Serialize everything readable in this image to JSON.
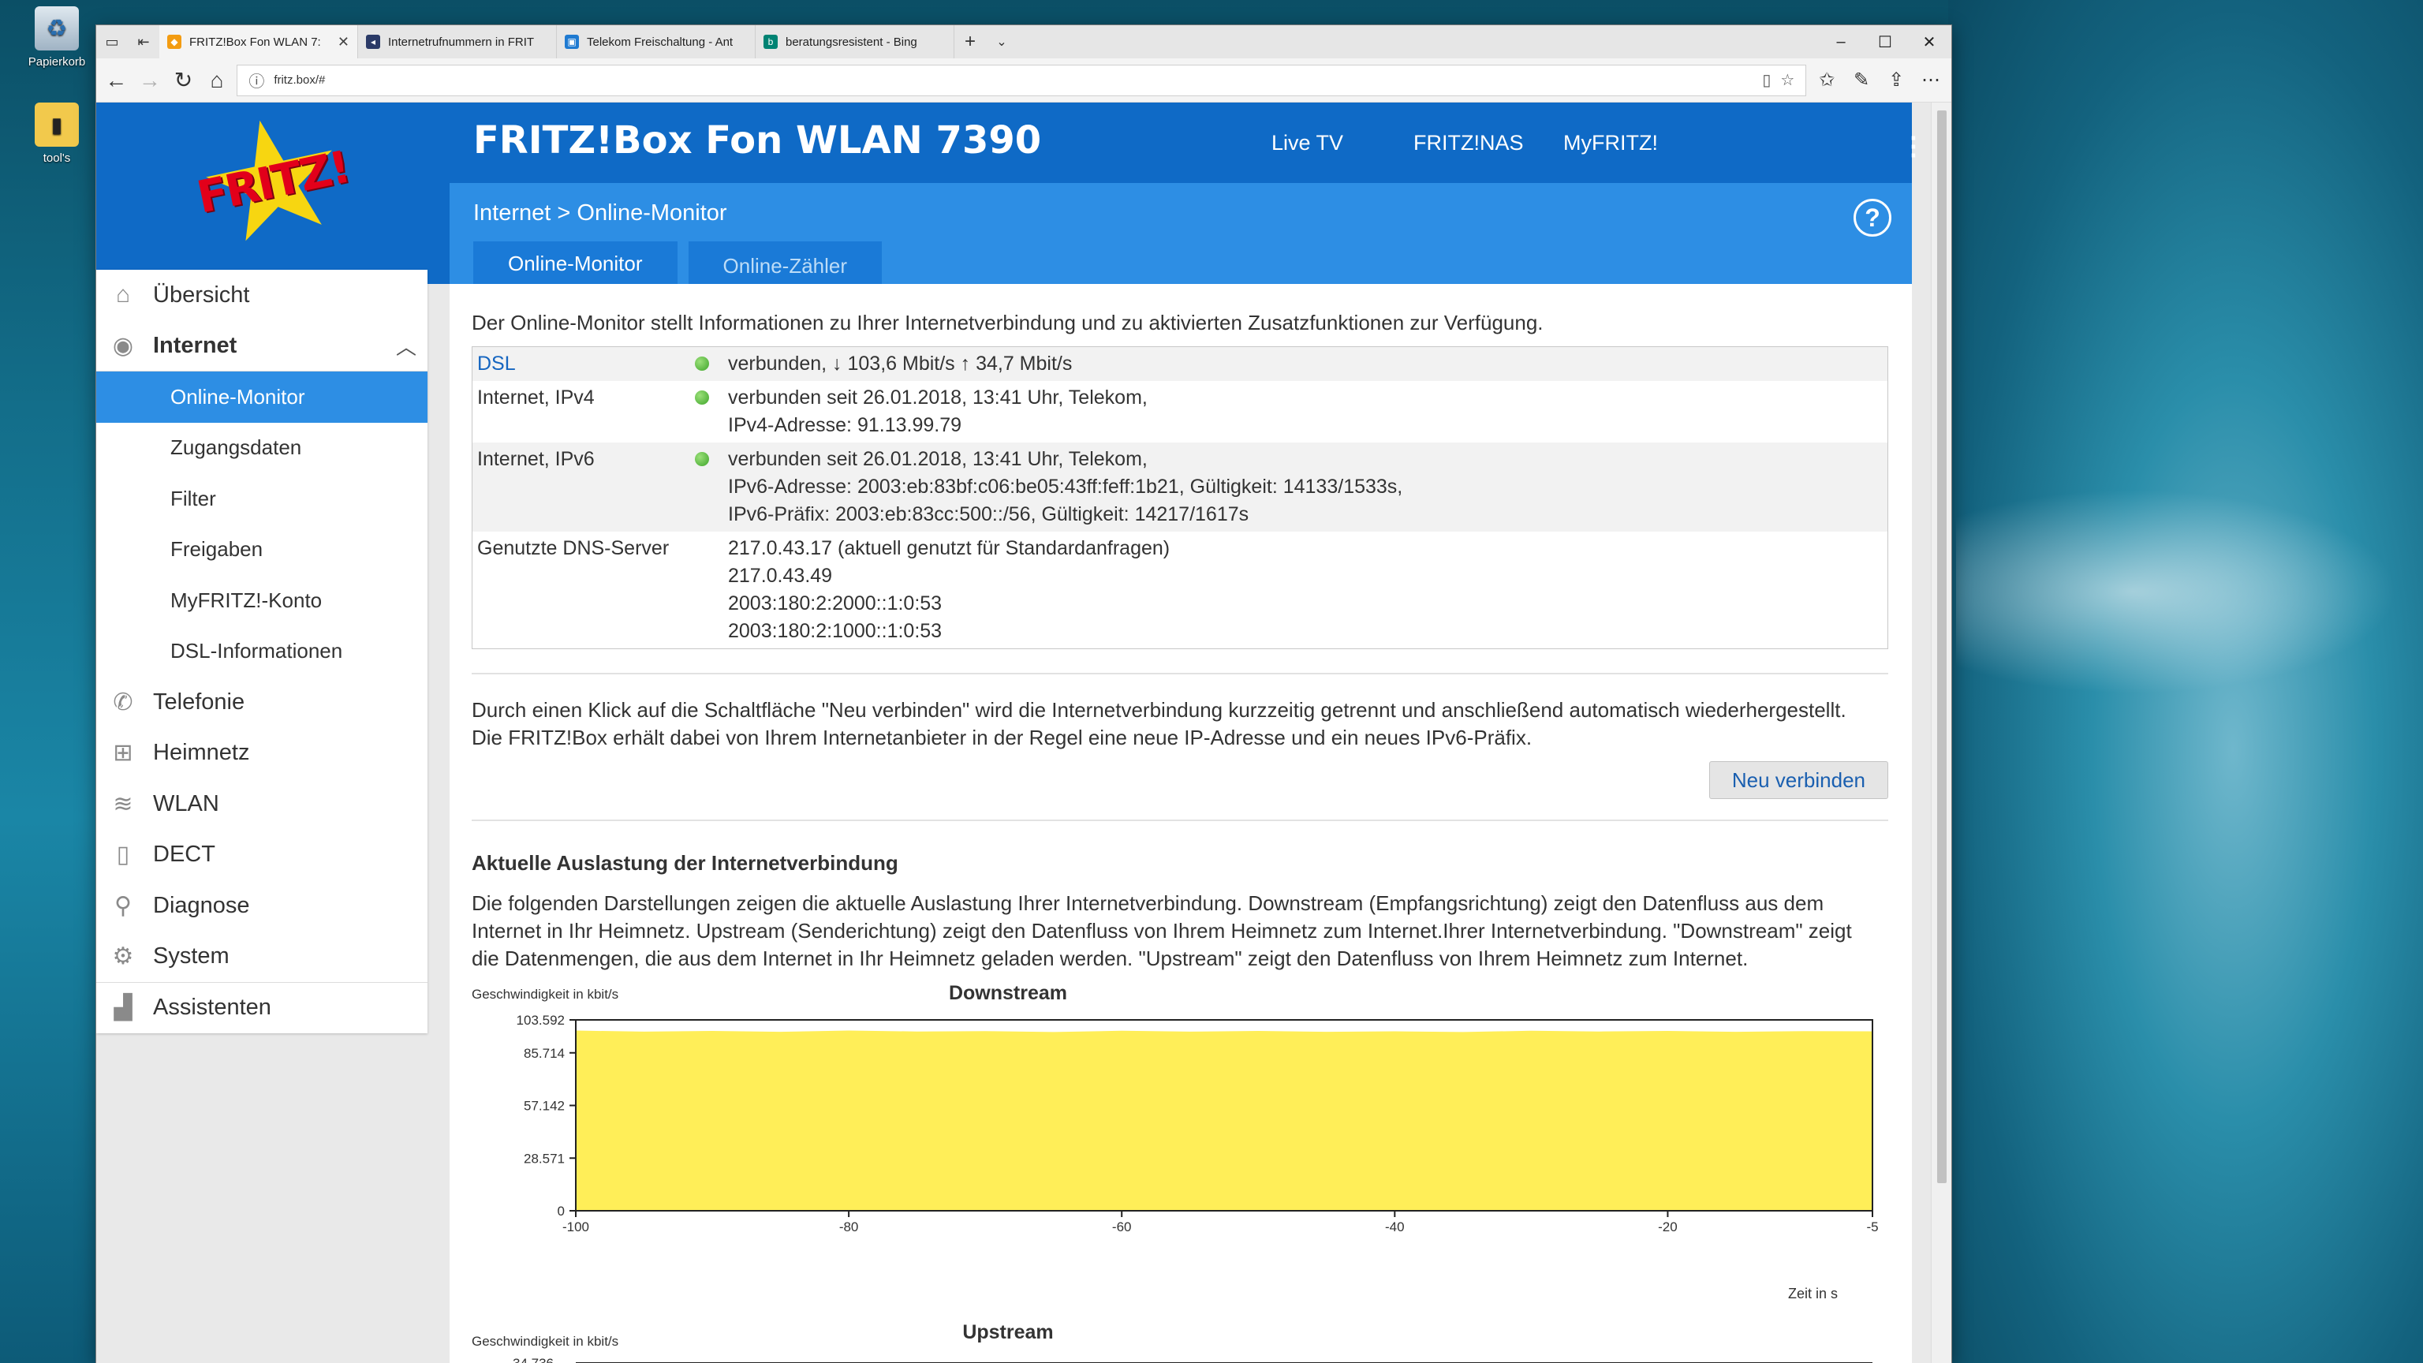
{
  "desktop": {
    "icons": [
      {
        "label": "Papierkorb",
        "icon": "recycle-bin-icon"
      },
      {
        "label": "tool's",
        "icon": "folder-icon"
      }
    ]
  },
  "browser": {
    "tabs": [
      {
        "title": "FRITZ!Box Fon WLAN 7:",
        "favicon": "fritz-favicon",
        "color": "#f39c12",
        "active": true
      },
      {
        "title": "Internetrufnummern in FRIT",
        "favicon": "fritz-favicon",
        "color": "#2b3a67",
        "active": false
      },
      {
        "title": "Telekom Freischaltung - Ant",
        "favicon": "forum-favicon",
        "color": "#1f7ad1",
        "active": false
      },
      {
        "title": "beratungsresistent - Bing",
        "favicon": "bing-favicon",
        "color": "#008373",
        "active": false
      }
    ],
    "url": "fritz.box/#"
  },
  "header": {
    "title": "FRITZ!Box Fon WLAN 7390",
    "logo": "FRITZ!",
    "nav": [
      "Live TV",
      "FRITZ!NAS",
      "MyFRITZ!"
    ]
  },
  "subheader": {
    "breadcrumb_root": "Internet",
    "breadcrumb_sep": ">",
    "breadcrumb_page": "Online-Monitor",
    "help": "?",
    "tabs": [
      "Online-Monitor",
      "Online-Zähler"
    ]
  },
  "sidebar": {
    "items": [
      {
        "label": "Übersicht",
        "icon": "home-icon"
      },
      {
        "label": "Internet",
        "icon": "globe-icon"
      },
      {
        "label": "Telefonie",
        "icon": "phone-icon"
      },
      {
        "label": "Heimnetz",
        "icon": "network-icon"
      },
      {
        "label": "WLAN",
        "icon": "wifi-icon"
      },
      {
        "label": "DECT",
        "icon": "dect-phone-icon"
      },
      {
        "label": "Diagnose",
        "icon": "diagnose-icon"
      },
      {
        "label": "System",
        "icon": "system-icon"
      },
      {
        "label": "Assistenten",
        "icon": "wizard-icon"
      }
    ],
    "internet_sub": [
      "Online-Monitor",
      "Zugangsdaten",
      "Filter",
      "Freigaben",
      "MyFRITZ!-Konto",
      "DSL-Informationen"
    ]
  },
  "content": {
    "intro": "Der Online-Monitor stellt Informationen zu Ihrer Internetverbindung und zu aktivierten Zusatzfunktionen zur Verfügung.",
    "status": [
      {
        "label": "DSL",
        "dot": true,
        "lines": [
          "verbunden, ↓ 103,6 Mbit/s ↑ 34,7 Mbit/s"
        ]
      },
      {
        "label": "Internet, IPv4",
        "dot": true,
        "lines": [
          "verbunden seit 26.01.2018, 13:41 Uhr, Telekom,",
          "IPv4-Adresse: 91.13.99.79"
        ]
      },
      {
        "label": "Internet, IPv6",
        "dot": true,
        "lines": [
          "verbunden seit 26.01.2018, 13:41 Uhr, Telekom,",
          "IPv6-Adresse: 2003:eb:83bf:c06:be05:43ff:feff:1b21, Gültigkeit: 14133/1533s,",
          "IPv6-Präfix: 2003:eb:83cc:500::/56, Gültigkeit: 14217/1617s"
        ]
      },
      {
        "label": "Genutzte DNS-Server",
        "dot": false,
        "lines": [
          "217.0.43.17 (aktuell genutzt für Standardanfragen)",
          "217.0.43.49",
          "2003:180:2:2000::1:0:53",
          "2003:180:2:1000::1:0:53"
        ]
      }
    ],
    "reconnect_text_1": "Durch einen Klick auf die Schaltfläche \"Neu verbinden\" wird die Internetverbindung kurzzeitig getrennt und anschließend automatisch wiederhergestellt.",
    "reconnect_text_2": "Die FRITZ!Box erhält dabei von Ihrem Internetanbieter in der Regel eine neue IP-Adresse und ein neues IPv6-Präfix.",
    "reconnect_button": "Neu verbinden",
    "load_heading": "Aktuelle Auslastung der Internetverbindung",
    "load_text_1": "Die folgenden Darstellungen zeigen die aktuelle Auslastung Ihrer Internetverbindung. Downstream (Empfangsrichtung) zeigt den Datenfluss aus dem",
    "load_text_2": "Internet in Ihr Heimnetz. Upstream (Senderichtung) zeigt den Datenfluss von Ihrem Heimnetz zum Internet.Ihrer Internetverbindung. \"Downstream\" zeigt",
    "load_text_3": "die Datenmengen, die aus dem Internet in Ihr Heimnetz geladen werden. \"Upstream\" zeigt den Datenfluss von Ihrem Heimnetz zum Internet."
  },
  "chart_data": [
    {
      "type": "area",
      "title": "Downstream",
      "ylabel": "Geschwindigkeit in kbit/s",
      "xlabel": "Zeit in s",
      "ylim": [
        0,
        103592
      ],
      "xlim": [
        -100,
        -5
      ],
      "yticks": [
        "0",
        "28.571",
        "57.142",
        "85.714",
        "103.592"
      ],
      "xticks": [
        "-100",
        "-80",
        "-60",
        "-40",
        "-20",
        "-5"
      ],
      "color": "#ffee58",
      "x": [
        -100,
        -95,
        -90,
        -85,
        -80,
        -75,
        -70,
        -65,
        -60,
        -55,
        -50,
        -45,
        -40,
        -35,
        -30,
        -25,
        -20,
        -15,
        -10,
        -5
      ],
      "values": [
        97800,
        97200,
        97600,
        97100,
        97800,
        97300,
        97500,
        97000,
        97700,
        97200,
        97600,
        97100,
        97400,
        97000,
        97700,
        97300,
        97600,
        97100,
        97500,
        97400
      ]
    },
    {
      "type": "area",
      "title": "Upstream",
      "ylabel": "Geschwindigkeit in kbit/s",
      "yticks": [
        "34.736"
      ]
    }
  ]
}
